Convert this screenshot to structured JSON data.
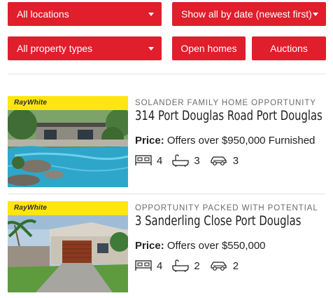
{
  "filters": {
    "location": "All locations",
    "sort": "Show all by date (newest first)",
    "property_type": "All property types",
    "open_homes": "Open homes",
    "auctions": "Auctions"
  },
  "brand": {
    "name": "RayWhite",
    "color": "#ffe512"
  },
  "accent_color": "#e01e2c",
  "listings": [
    {
      "tag": "SOLANDER FAMILY HOME OPPORTUNITY",
      "address": "314 Port Douglas Road Port Douglas",
      "price_label": "Price:",
      "price": "Offers over $950,000 Furnished",
      "beds": "4",
      "baths": "3",
      "cars": "3"
    },
    {
      "tag": "OPPORTUNITY PACKED WITH POTENTIAL",
      "address": "3 Sanderling Close Port Douglas",
      "price_label": "Price:",
      "price": "Offers over $550,000",
      "beds": "4",
      "baths": "2",
      "cars": "2"
    }
  ],
  "icons": [
    "bed-icon",
    "bath-icon",
    "car-icon",
    "chevron-down-icon"
  ]
}
